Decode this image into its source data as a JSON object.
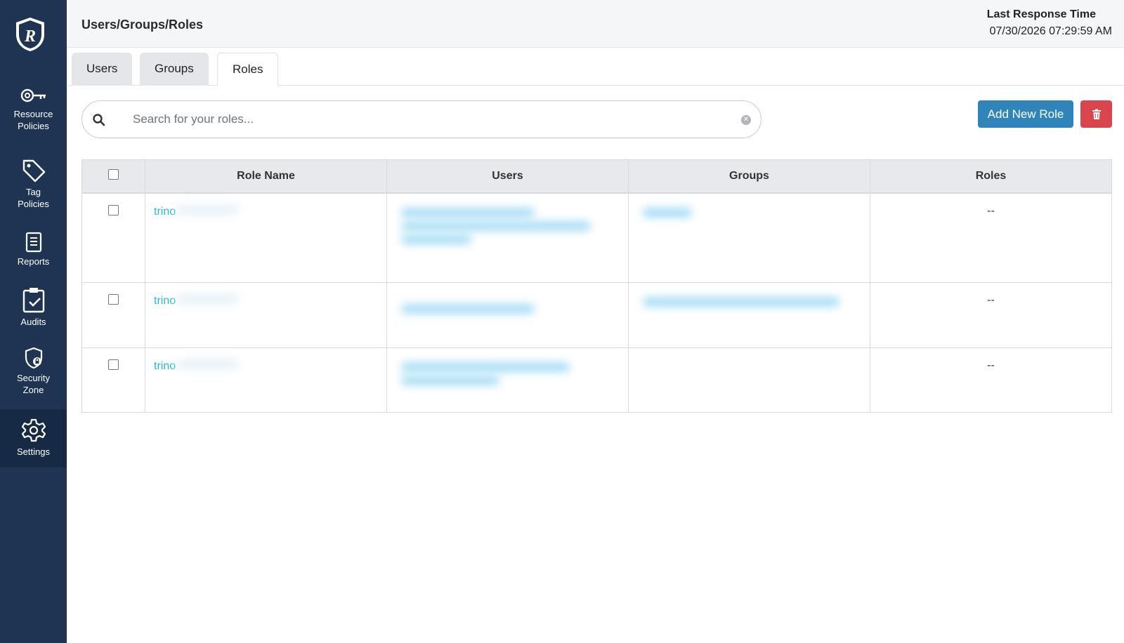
{
  "sidebar": {
    "items": [
      {
        "label": "Resource Policies",
        "icon": "key-icon"
      },
      {
        "label": "Tag Policies",
        "icon": "tag-icon"
      },
      {
        "label": "Reports",
        "icon": "document-icon"
      },
      {
        "label": "Audits",
        "icon": "clipboard-check-icon"
      },
      {
        "label": "Security Zone",
        "icon": "shield-lock-icon"
      },
      {
        "label": "Settings",
        "icon": "gear-icon",
        "active": true
      }
    ]
  },
  "header": {
    "breadcrumb": "Users/Groups/Roles",
    "last_response_label": "Last Response Time",
    "last_response_value": "07/30/2026 07:29:59 AM"
  },
  "tabs": [
    {
      "label": "Users"
    },
    {
      "label": "Groups"
    },
    {
      "label": "Roles",
      "active": true
    }
  ],
  "search": {
    "placeholder": "Search for your roles...",
    "value": ""
  },
  "actions": {
    "add_label": "Add New Role"
  },
  "table": {
    "columns": [
      "Role Name",
      "Users",
      "Groups",
      "Roles"
    ],
    "rows": [
      {
        "role_name": "trino",
        "roles": "--"
      },
      {
        "role_name": "trino",
        "roles": "--"
      },
      {
        "role_name": "trino",
        "roles": "--"
      }
    ]
  },
  "colors": {
    "sidebar_bg": "#1f3452",
    "primary": "#2f84b9",
    "danger": "#d9454d",
    "link": "#27b4e0"
  }
}
